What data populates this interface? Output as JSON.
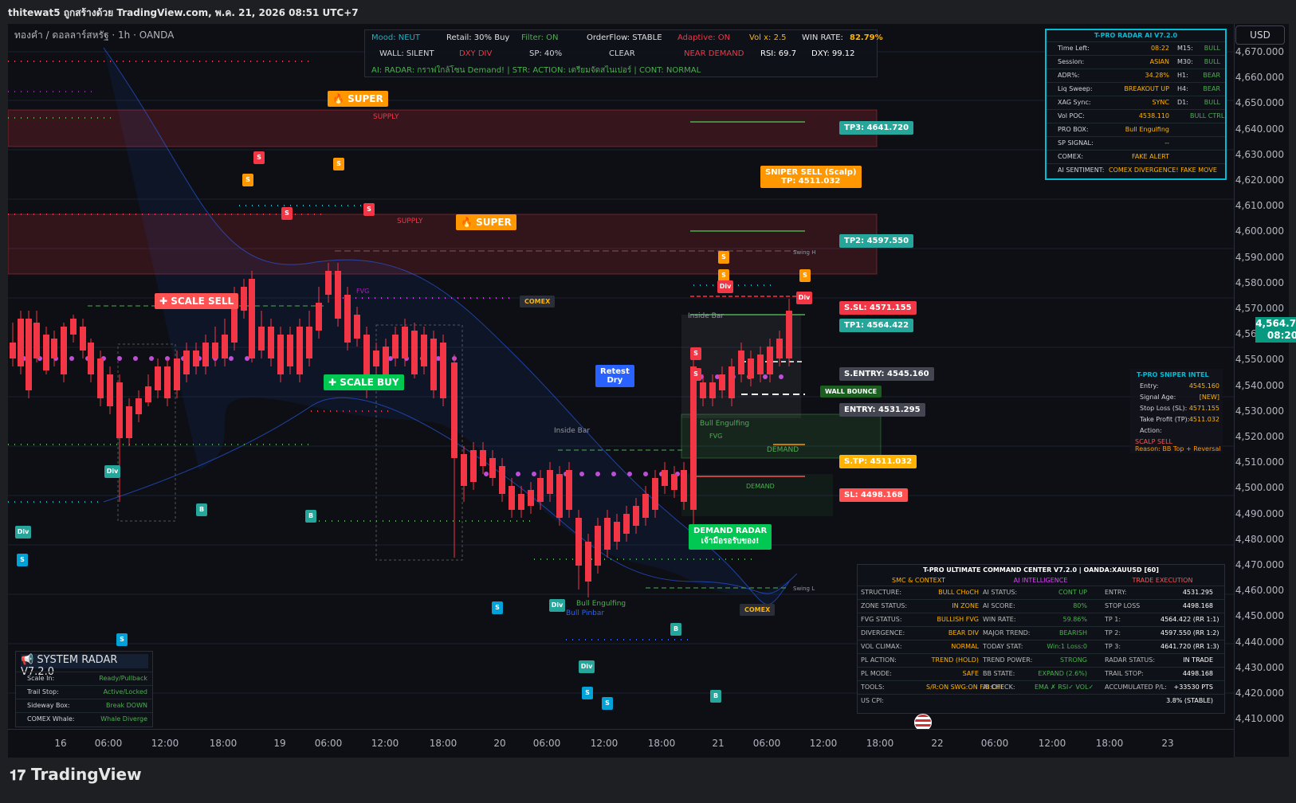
{
  "window": {
    "title": "thitewat5 ถูกสร้างด้วย TradingView.com, พ.ค. 21, 2026 08:51 UTC+7"
  },
  "symbol": {
    "label": "ทองคำ / ดอลลาร์สหรัฐ · 1h · OANDA"
  },
  "currency": "USD",
  "current_price": {
    "price": "4,564.755",
    "countdown": "08:20"
  },
  "price_axis": [
    "4,670.000",
    "4,660.000",
    "4,650.000",
    "4,640.000",
    "4,630.000",
    "4,620.000",
    "4,610.000",
    "4,600.000",
    "4,590.000",
    "4,580.000",
    "4,570.000",
    "4,560.000",
    "4,550.000",
    "4,540.000",
    "4,530.000",
    "4,520.000",
    "4,510.000",
    "4,500.000",
    "4,490.000",
    "4,480.000",
    "4,470.000",
    "4,460.000",
    "4,450.000",
    "4,440.000",
    "4,430.000",
    "4,420.000",
    "4,410.000"
  ],
  "time_axis": [
    "16",
    "06:00",
    "12:00",
    "18:00",
    "19",
    "06:00",
    "12:00",
    "18:00",
    "20",
    "06:00",
    "12:00",
    "18:00",
    "21",
    "06:00",
    "12:00",
    "18:00",
    "22",
    "06:00",
    "12:00",
    "18:00",
    "23"
  ],
  "top_hud": {
    "row1": [
      "Mood: NEUT",
      "Retail: 30% Buy",
      "Filter: ON",
      "OrderFlow: STABLE",
      "Adaptive: ON",
      "Vol x: 2.5",
      "WIN RATE:",
      "82.79%"
    ],
    "row2": [
      "WALL: SILENT",
      "DXY DIV",
      "SP: 40%",
      "CLEAR",
      "NEAR DEMAND",
      "RSI: 69.7",
      "DXY: 99.12"
    ],
    "row3": "AI: RADAR: กราฟใกล้โซน Demand! | STR: ACTION: เตรียมจัดสไนเปอร์ | CONT: NORMAL"
  },
  "radar_table": {
    "title": "T-PRO RADAR AI V7.2.0",
    "rows": [
      {
        "k": "Time Left:",
        "v": "08:22",
        "tf": "M15:",
        "s": "BULL"
      },
      {
        "k": "Session:",
        "v": "ASIAN",
        "tf": "M30:",
        "s": "BULL"
      },
      {
        "k": "ADR%:",
        "v": "34.28%",
        "tf": "H1:",
        "s": "BEAR"
      },
      {
        "k": "Liq Sweep:",
        "v": "BREAKOUT UP",
        "tf": "H4:",
        "s": "BEAR"
      },
      {
        "k": "XAG Sync:",
        "v": "SYNC",
        "tf": "D1:",
        "s": "BULL"
      },
      {
        "k": "Vol POC:",
        "v": "4538.110",
        "tf": "",
        "s": "BULL CTRL"
      },
      {
        "k": "PRO BOX:",
        "v": "Bull Engulfing",
        "tf": "",
        "s": ""
      },
      {
        "k": "SP SIGNAL:",
        "v": "--",
        "tf": "",
        "s": ""
      },
      {
        "k": "COMEX:",
        "v": "FAKE ALERT",
        "tf": "",
        "s": ""
      },
      {
        "k": "AI SENTIMENT:",
        "v": "COMEX DIVERGENCE! FAKE MOVE",
        "tf": "",
        "s": ""
      }
    ]
  },
  "sniper_intel": {
    "title": "T-PRO SNIPER INTEL",
    "rows": [
      {
        "k": "Entry:",
        "v": "4545.160"
      },
      {
        "k": "Signal Age:",
        "v": "[NEW]"
      },
      {
        "k": "Stop Loss (SL):",
        "v": "4571.155"
      },
      {
        "k": "Take Profit (TP):",
        "v": "4511.032"
      },
      {
        "k": "Action:",
        "v": ""
      }
    ],
    "action": "SCALP SELL",
    "reason": "Reason: BB Top + Reversal"
  },
  "system_radar": {
    "title": "SYSTEM RADAR V7.2.0",
    "rows": [
      {
        "k": "Scale In:",
        "v": "Ready/Pullback"
      },
      {
        "k": "Trail Stop:",
        "v": "Active/Locked"
      },
      {
        "k": "Sideway Box:",
        "v": "Break DOWN"
      },
      {
        "k": "COMEX Whale:",
        "v": "Whale Diverge"
      }
    ]
  },
  "command_center": {
    "title": "T-PRO ULTIMATE COMMAND CENTER V7.2.0 | OANDA:XAUUSD [60]",
    "headers": [
      "SMC & CONTEXT",
      "AI INTELLIGENCE",
      "TRADE EXECUTION"
    ],
    "rows": [
      [
        "STRUCTURE:",
        "BULL CHoCH",
        "AI STATUS:",
        "CONT UP",
        "ENTRY:",
        "4531.295"
      ],
      [
        "ZONE STATUS:",
        "IN ZONE",
        "AI SCORE:",
        "80%",
        "STOP LOSS",
        "4498.168"
      ],
      [
        "FVG STATUS:",
        "BULLISH FVG",
        "WIN RATE:",
        "59.86%",
        "TP 1:",
        "4564.422 (RR 1:1)"
      ],
      [
        "DIVERGENCE:",
        "BEAR DIV",
        "MAJOR TREND:",
        "BEARISH",
        "TP 2:",
        "4597.550 (RR 1:2)"
      ],
      [
        "VOL CLIMAX:",
        "NORMAL",
        "TODAY STAT:",
        "Win:1 Loss:0",
        "TP 3:",
        "4641.720 (RR 1:3)"
      ],
      [
        "PL ACTION:",
        "TREND (HOLD)",
        "TREND POWER:",
        "STRONG",
        "RADAR STATUS:",
        "IN TRADE"
      ],
      [
        "PL MODE:",
        "SAFE",
        "BB STATE:",
        "EXPAND (2.6%)",
        "TRAIL STOP:",
        "4498.168"
      ],
      [
        "TOOLS:",
        "S/R:ON SWG:ON FIB:OFF",
        "AI CHECK:",
        "EMA ✗ RSI✓ VOL✓",
        "ACCUMULATED P/L:",
        "+33530 PTS"
      ],
      [
        "US CPI:",
        "",
        "",
        "",
        "",
        "3.8% (STABLE)"
      ]
    ]
  },
  "levels": {
    "tp3": "TP3: 4641.720",
    "tp2": "TP2: 4597.550",
    "ssl": "S.SL: 4571.155",
    "tp1": "TP1: 4564.422",
    "sentry": "S.ENTRY: 4545.160",
    "entry": "ENTRY: 4531.295",
    "stp": "S.TP: 4511.032",
    "sl": "SL: 4498.168"
  },
  "annotations": {
    "supply": "SUPPLY",
    "demand": "DEMAND",
    "super": "SUPER",
    "scale_sell": "SCALE SELL",
    "scale_buy": "SCALE BUY",
    "sniper_sell": "SNIPER SELL (Scalp)",
    "sniper_tp": "TP: 4511.032",
    "retest": "Retest",
    "dry": "Dry",
    "demand_radar": "DEMAND RADAR",
    "demand_radar_sub": "เจ้ามือรอรับของ!",
    "comex": "COMEX",
    "wall_bounce": "WALL BOUNCE",
    "inside_bar": "Inside Bar",
    "bull_engulfing": "Bull Engulfing",
    "bull_pinbar": "Bull Pinbar",
    "fvg": "FVG",
    "swing_h": "Swing H",
    "swing_l": "Swing L",
    "div": "Div"
  },
  "brand": "TradingView",
  "colors": {
    "bull": "#26a69a",
    "bear": "#f23645",
    "accent": "#ff9800",
    "hud_border": "#00bcd4"
  }
}
